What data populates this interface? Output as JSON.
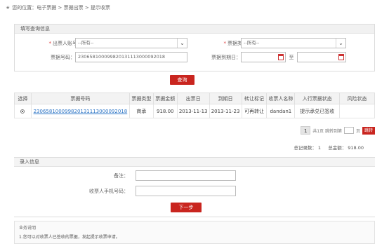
{
  "breadcrumb": {
    "text": "您的位置：电子票据 > 票据出票 > 提示收票"
  },
  "query": {
    "title": "填写查询信息",
    "account_label": "出票人账号：",
    "account_value": "--所有--",
    "bill_type_label": "票据类型：",
    "bill_type_value": "--所有--",
    "bill_no_label": "票据号码：",
    "bill_no_value": "230658100099820131113000092018",
    "due_date_label": "票据到期日：",
    "due_date_to": "至",
    "query_button": "查询"
  },
  "table": {
    "headers": [
      "选择",
      "票据号码",
      "票据类型",
      "票据金额",
      "出票日",
      "到期日",
      "转让标记",
      "收票人名称",
      "入行票据状态",
      "风险状态"
    ],
    "rows": [
      {
        "bill_no": "230658100099820131113000092018",
        "type": "商承",
        "amount": "918.00",
        "issue_date": "2013-11-13",
        "due_date": "2013-11-23",
        "transfer": "可再转让",
        "payee": "dandan1",
        "status": "提示承兑已签收",
        "risk": ""
      }
    ]
  },
  "pager": {
    "current": "1",
    "info": "共1页 跳转到第",
    "page_unit": "页",
    "go": "跳转"
  },
  "totals": {
    "count_label": "总记录数：",
    "count": "1",
    "amount_label": "总金额：",
    "amount": "918.00"
  },
  "entry": {
    "title": "录入信息",
    "remark_label": "备注：",
    "phone_label": "收票人手机号码：",
    "next_button": "下一步"
  },
  "notes": {
    "title": "业务说明",
    "text": "1.您可以对收票人已签收的票据，发起提示收票申请。"
  },
  "colors": {
    "accent": "#c9251f",
    "link": "#2a73c5"
  }
}
